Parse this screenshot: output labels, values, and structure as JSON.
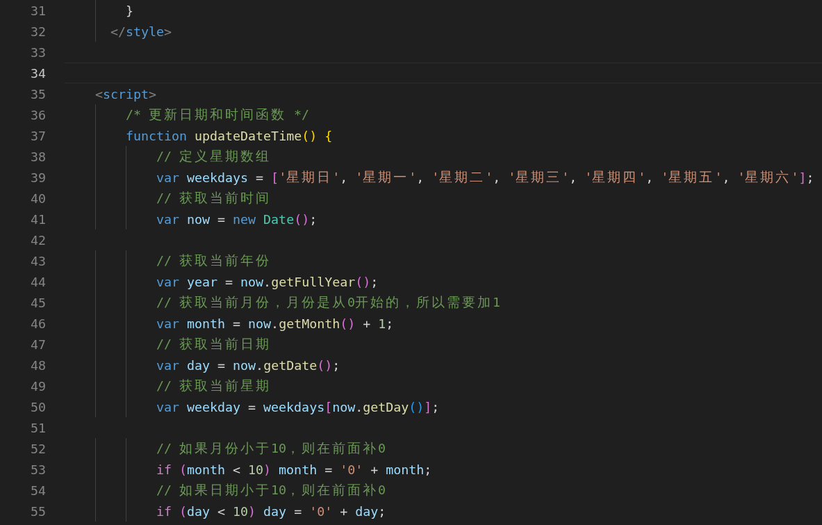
{
  "editor": {
    "lines": [
      {
        "children": [
          {
            "children": [
              {
                "children": [
                  {
                    "children": [
                      {
                        "number": "31",
                        "current": false,
                        "tokens": [
                          {
                            "kind": "plain",
                            "text": "}"
                          }
                        ]
                      }
                    ]
                  },
                  {
                    "number": "32",
                    "current": false,
                    "tokens": [
                      {
                        "kind": "tagp",
                        "text": "</"
                      },
                      {
                        "kind": "tag",
                        "text": "style"
                      },
                      {
                        "kind": "tagp",
                        "text": ">"
                      }
                    ]
                  }
                ]
              },
              {
                "number": "33",
                "current": false
              },
              {
                "number": "34",
                "current": true
              },
              {
                "number": "35",
                "current": false,
                "tokens": [
                  {
                    "kind": "tagp",
                    "text": "<"
                  },
                  {
                    "kind": "tag",
                    "text": "script"
                  },
                  {
                    "kind": "tagp",
                    "text": ">"
                  }
                ]
              },
              {
                "children": [
                  {
                    "children": [
                      {
                        "number": "36",
                        "current": false,
                        "tokens": [
                          {
                            "kind": "comment",
                            "text": "/* 更新日期和时间函数 */"
                          }
                        ]
                      },
                      {
                        "number": "37",
                        "current": false,
                        "tokens": [
                          {
                            "kind": "keyword",
                            "text": "function"
                          },
                          {
                            "kind": "fn",
                            "text": "updateDateTime",
                            "sp": true
                          },
                          {
                            "kind": "b1",
                            "text": "()"
                          },
                          {
                            "kind": "b1",
                            "text": "{",
                            "sp": true
                          }
                        ]
                      },
                      {
                        "children": [
                          {
                            "children": [
                              {
                                "number": "38",
                                "current": false,
                                "tokens": [
                                  {
                                    "kind": "comment",
                                    "text": "// 定义星期数组"
                                  }
                                ]
                              },
                              {
                                "number": "39",
                                "current": false,
                                "tokens": [
                                  {
                                    "kind": "keyword",
                                    "text": "var"
                                  },
                                  {
                                    "kind": "variable",
                                    "text": "weekdays",
                                    "sp": true
                                  },
                                  {
                                    "kind": "plain",
                                    "text": "=",
                                    "sp": true
                                  },
                                  {
                                    "kind": "b2",
                                    "text": "[",
                                    "sp": true
                                  },
                                  {
                                    "kind": "string",
                                    "text": "'星期日'"
                                  },
                                  {
                                    "kind": "plain",
                                    "text": ","
                                  },
                                  {
                                    "kind": "string",
                                    "text": "'星期一'",
                                    "sp": true
                                  },
                                  {
                                    "kind": "plain",
                                    "text": ","
                                  },
                                  {
                                    "kind": "string",
                                    "text": "'星期二'",
                                    "sp": true
                                  },
                                  {
                                    "kind": "plain",
                                    "text": ","
                                  },
                                  {
                                    "kind": "string",
                                    "text": "'星期三'",
                                    "sp": true
                                  },
                                  {
                                    "kind": "plain",
                                    "text": ","
                                  },
                                  {
                                    "kind": "string",
                                    "text": "'星期四'",
                                    "sp": true
                                  },
                                  {
                                    "kind": "plain",
                                    "text": ","
                                  },
                                  {
                                    "kind": "string",
                                    "text": "'星期五'",
                                    "sp": true
                                  },
                                  {
                                    "kind": "plain",
                                    "text": ","
                                  },
                                  {
                                    "kind": "string",
                                    "text": "'星期六'",
                                    "sp": true
                                  },
                                  {
                                    "kind": "b2",
                                    "text": "]"
                                  },
                                  {
                                    "kind": "plain",
                                    "text": ";"
                                  }
                                ]
                              },
                              {
                                "number": "40",
                                "current": false,
                                "tokens": [
                                  {
                                    "kind": "comment",
                                    "text": "// 获取当前时间"
                                  }
                                ]
                              },
                              {
                                "number": "41",
                                "current": false,
                                "tokens": [
                                  {
                                    "kind": "keyword",
                                    "text": "var"
                                  },
                                  {
                                    "kind": "variable",
                                    "text": "now",
                                    "sp": true
                                  },
                                  {
                                    "kind": "plain",
                                    "text": "=",
                                    "sp": true
                                  },
                                  {
                                    "kind": "keyword",
                                    "text": "new",
                                    "sp": true
                                  },
                                  {
                                    "kind": "class",
                                    "text": "Date",
                                    "sp": true
                                  },
                                  {
                                    "kind": "b2",
                                    "text": "()"
                                  },
                                  {
                                    "kind": "plain",
                                    "text": ";"
                                  }
                                ]
                              },
                              {
                                "number": "42",
                                "current": false
                              },
                              {
                                "number": "43",
                                "current": false,
                                "tokens": [
                                  {
                                    "kind": "comment",
                                    "text": "// 获取当前年份"
                                  }
                                ]
                              },
                              {
                                "number": "44",
                                "current": false,
                                "tokens": [
                                  {
                                    "kind": "keyword",
                                    "text": "var"
                                  },
                                  {
                                    "kind": "variable",
                                    "text": "year",
                                    "sp": true
                                  },
                                  {
                                    "kind": "plain",
                                    "text": "=",
                                    "sp": true
                                  },
                                  {
                                    "kind": "variable",
                                    "text": "now",
                                    "sp": true
                                  },
                                  {
                                    "kind": "plain",
                                    "text": "."
                                  },
                                  {
                                    "kind": "fn",
                                    "text": "getFullYear"
                                  },
                                  {
                                    "kind": "b2",
                                    "text": "()"
                                  },
                                  {
                                    "kind": "plain",
                                    "text": ";"
                                  }
                                ]
                              },
                              {
                                "number": "45",
                                "current": false,
                                "tokens": [
                                  {
                                    "kind": "comment",
                                    "text": "// 获取当前月份，月份是从0开始的，所以需要加1"
                                  }
                                ]
                              },
                              {
                                "number": "46",
                                "current": false,
                                "tokens": [
                                  {
                                    "kind": "keyword",
                                    "text": "var"
                                  },
                                  {
                                    "kind": "variable",
                                    "text": "month",
                                    "sp": true
                                  },
                                  {
                                    "kind": "plain",
                                    "text": "=",
                                    "sp": true
                                  },
                                  {
                                    "kind": "variable",
                                    "text": "now",
                                    "sp": true
                                  },
                                  {
                                    "kind": "plain",
                                    "text": "."
                                  },
                                  {
                                    "kind": "fn",
                                    "text": "getMonth"
                                  },
                                  {
                                    "kind": "b2",
                                    "text": "()"
                                  },
                                  {
                                    "kind": "plain",
                                    "text": "+",
                                    "sp": true
                                  },
                                  {
                                    "kind": "number",
                                    "text": "1",
                                    "sp": true
                                  },
                                  {
                                    "kind": "plain",
                                    "text": ";"
                                  }
                                ]
                              },
                              {
                                "number": "47",
                                "current": false,
                                "tokens": [
                                  {
                                    "kind": "comment",
                                    "text": "// 获取当前日期"
                                  }
                                ]
                              },
                              {
                                "number": "48",
                                "current": false,
                                "tokens": [
                                  {
                                    "kind": "keyword",
                                    "text": "var"
                                  },
                                  {
                                    "kind": "variable",
                                    "text": "day",
                                    "sp": true
                                  },
                                  {
                                    "kind": "plain",
                                    "text": "=",
                                    "sp": true
                                  },
                                  {
                                    "kind": "variable",
                                    "text": "now",
                                    "sp": true
                                  },
                                  {
                                    "kind": "plain",
                                    "text": "."
                                  },
                                  {
                                    "kind": "fn",
                                    "text": "getDate"
                                  },
                                  {
                                    "kind": "b2",
                                    "text": "()"
                                  },
                                  {
                                    "kind": "plain",
                                    "text": ";"
                                  }
                                ]
                              },
                              {
                                "number": "49",
                                "current": false,
                                "tokens": [
                                  {
                                    "kind": "comment",
                                    "text": "// 获取当前星期"
                                  }
                                ]
                              },
                              {
                                "number": "50",
                                "current": false,
                                "tokens": [
                                  {
                                    "kind": "keyword",
                                    "text": "var"
                                  },
                                  {
                                    "kind": "variable",
                                    "text": "weekday",
                                    "sp": true
                                  },
                                  {
                                    "kind": "plain",
                                    "text": "=",
                                    "sp": true
                                  },
                                  {
                                    "kind": "variable",
                                    "text": "weekdays",
                                    "sp": true
                                  },
                                  {
                                    "kind": "b2",
                                    "text": "["
                                  },
                                  {
                                    "kind": "variable",
                                    "text": "now"
                                  },
                                  {
                                    "kind": "plain",
                                    "text": "."
                                  },
                                  {
                                    "kind": "fn",
                                    "text": "getDay"
                                  },
                                  {
                                    "kind": "b3",
                                    "text": "()"
                                  },
                                  {
                                    "kind": "b2",
                                    "text": "]"
                                  },
                                  {
                                    "kind": "plain",
                                    "text": ";"
                                  }
                                ]
                              },
                              {
                                "number": "51",
                                "current": false
                              },
                              {
                                "number": "52",
                                "current": false,
                                "tokens": [
                                  {
                                    "kind": "comment",
                                    "text": "// 如果月份小于10，则在前面补0"
                                  }
                                ]
                              },
                              {
                                "number": "53",
                                "current": false,
                                "tokens": [
                                  {
                                    "kind": "control",
                                    "text": "if"
                                  },
                                  {
                                    "kind": "b2",
                                    "text": "(",
                                    "sp": true
                                  },
                                  {
                                    "kind": "variable",
                                    "text": "month"
                                  },
                                  {
                                    "kind": "plain",
                                    "text": "<",
                                    "sp": true
                                  },
                                  {
                                    "kind": "number",
                                    "text": "10",
                                    "sp": true
                                  },
                                  {
                                    "kind": "b2",
                                    "text": ")"
                                  },
                                  {
                                    "kind": "variable",
                                    "text": "month",
                                    "sp": true
                                  },
                                  {
                                    "kind": "plain",
                                    "text": "=",
                                    "sp": true
                                  },
                                  {
                                    "kind": "string",
                                    "text": "'0'",
                                    "sp": true
                                  },
                                  {
                                    "kind": "plain",
                                    "text": "+",
                                    "sp": true
                                  },
                                  {
                                    "kind": "variable",
                                    "text": "month",
                                    "sp": true
                                  },
                                  {
                                    "kind": "plain",
                                    "text": ";"
                                  }
                                ]
                              },
                              {
                                "number": "54",
                                "current": false,
                                "tokens": [
                                  {
                                    "kind": "comment",
                                    "text": "// 如果日期小于10，则在前面补0"
                                  }
                                ]
                              },
                              {
                                "number": "55",
                                "current": false,
                                "tokens": [
                                  {
                                    "kind": "control",
                                    "text": "if"
                                  },
                                  {
                                    "kind": "b2",
                                    "text": "(",
                                    "sp": true
                                  },
                                  {
                                    "kind": "variable",
                                    "text": "day"
                                  },
                                  {
                                    "kind": "plain",
                                    "text": "<",
                                    "sp": true
                                  },
                                  {
                                    "kind": "number",
                                    "text": "10",
                                    "sp": true
                                  },
                                  {
                                    "kind": "b2",
                                    "text": ")"
                                  },
                                  {
                                    "kind": "variable",
                                    "text": "day",
                                    "sp": true
                                  },
                                  {
                                    "kind": "plain",
                                    "text": "=",
                                    "sp": true
                                  },
                                  {
                                    "kind": "string",
                                    "text": "'0'",
                                    "sp": true
                                  },
                                  {
                                    "kind": "plain",
                                    "text": "+",
                                    "sp": true
                                  },
                                  {
                                    "kind": "variable",
                                    "text": "day",
                                    "sp": true
                                  },
                                  {
                                    "kind": "plain",
                                    "text": ";"
                                  }
                                ]
                              }
                            ]
                          }
                        ]
                      }
                    ]
                  }
                ]
              }
            ]
          }
        ]
      }
    ]
  }
}
